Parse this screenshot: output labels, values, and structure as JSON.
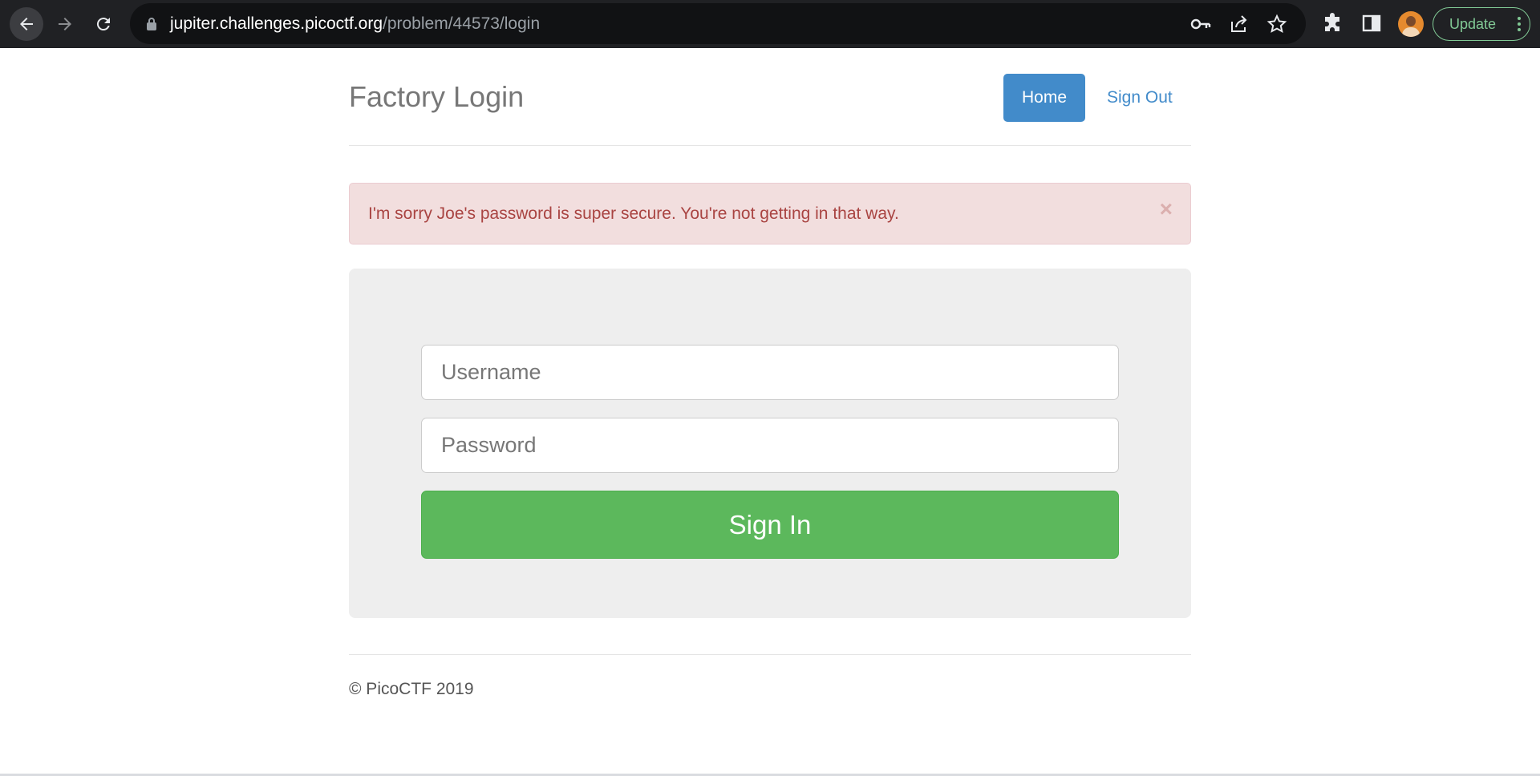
{
  "browser": {
    "url_host": "jupiter.challenges.picoctf.org",
    "url_path": "/problem/44573/login",
    "update_label": "Update"
  },
  "site": {
    "title": "Factory Login",
    "nav": {
      "home_label": "Home",
      "signout_label": "Sign Out"
    }
  },
  "alert": {
    "message": "I'm sorry Joe's password is super secure. You're not getting in that way.",
    "close_glyph": "×"
  },
  "login_form": {
    "username_placeholder": "Username",
    "password_placeholder": "Password",
    "submit_label": "Sign In"
  },
  "footer": {
    "text": "© PicoCTF 2019"
  },
  "colors": {
    "primary": "#428bca",
    "success": "#5cb85c",
    "alert_bg": "#f2dede",
    "alert_text": "#a94442"
  }
}
